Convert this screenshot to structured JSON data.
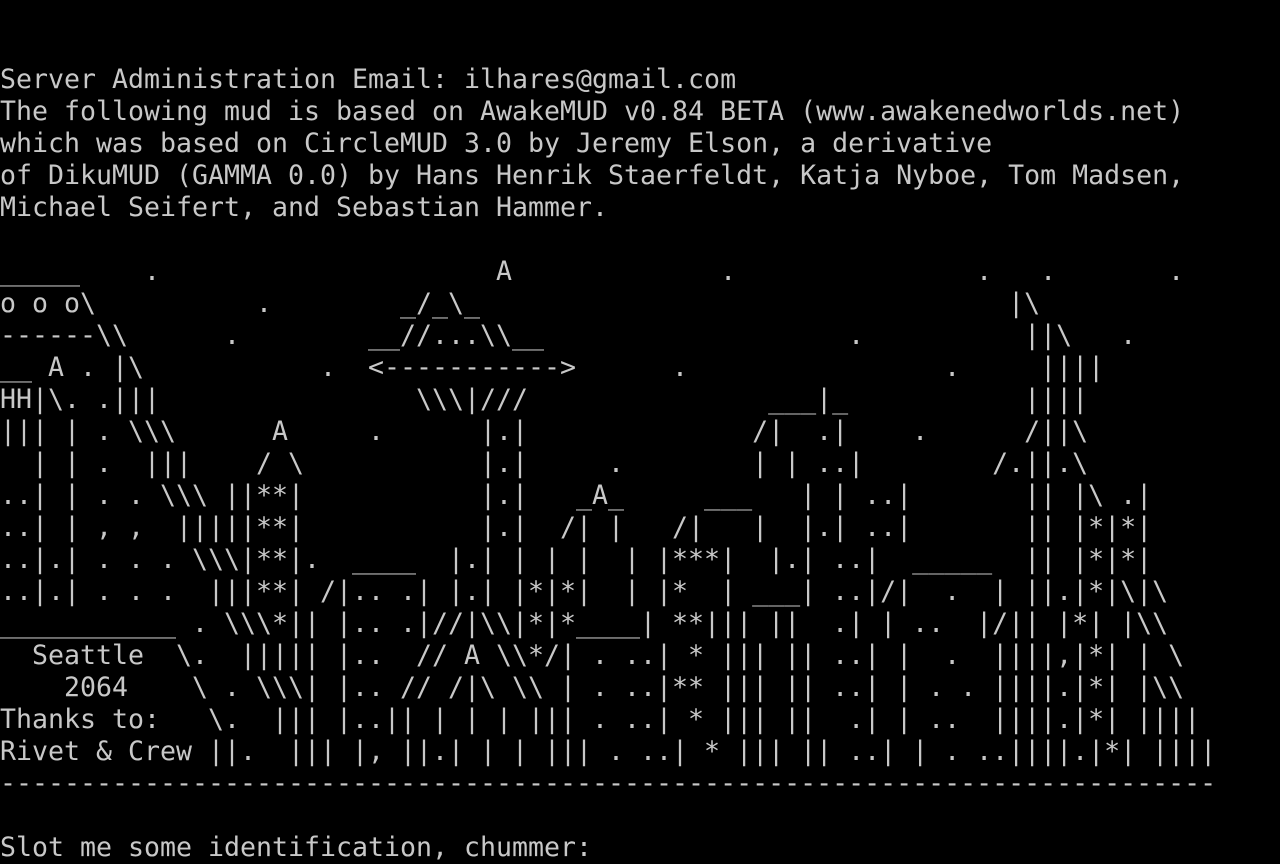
{
  "terminal": {
    "text_color": "#c8c8c8",
    "background_color": "#000000",
    "lines": [
      "Server Administration Email: ilhares@gmail.com",
      "The following mud is based on AwakeMUD v0.84 BETA (www.awakenedworlds.net)",
      "which was based on CircleMUD 3.0 by Jeremy Elson, a derivative",
      "of DikuMUD (GAMMA 0.0) by Hans Henrik Staerfeldt, Katja Nyboe, Tom Madsen,",
      "Michael Seifert, and Sebastian Hammer.",
      "",
      "_____    .                     A             .               .   .       .",
      "o o o\\          .        _/_\\_                                 |\\",
      "------\\\\      .        __//...\\\\__                   .          ||\\   .",
      "__ A . |\\           .  <----------->      .                .     ||||",
      "HH|\\. .|||                \\\\\\|///               ___|_           ||||",
      "||| | . \\\\\\      A     .      |.|              /|  .|    .      /||\\",
      "  | | .  |||    / \\           |.|     .        | | ..|        /.||.\\",
      "..| | . . \\\\\\ ||**|           |.|   _A_     ___   | | ..|       || |\\ .|",
      "..| | , ,  |||||**|           |.|  /| |   /|   |  |.| ..|       || |*|*|",
      "..|.| . . . \\\\\\|**|.  ____  |.| | | |  | |***|  |.| ..|  _____  || |*|*|",
      "..|.| . . .  |||**| /|.. .| |.| |*|*|  | |*  | ___| ..|/|  .  | ||.|*|\\|\\",
      "___________ . \\\\\\*|| |.. .|//|\\\\|*|*____| **||| ||  .| | ..  |/|| |*| |\\\\",
      "  Seattle  \\.  ||||| |..  // A \\\\*/| . ..| * ||| || ..| |  .  ||||,|*| | \\",
      "    2064    \\ . \\\\\\| |.. // /|\\ \\\\ | . ..|** ||| || ..| | . . ||||.|*| |\\\\",
      "Thanks to:   \\.  ||| |..|| | | | ||| . ..| * ||| ||  .| | ..  ||||.|*| ||||",
      "Rivet & Crew ||.  ||| |, ||.| | | ||| . ..| * ||| || ..| | . ..||||.|*| ||||",
      "----------------------------------------------------------------------------",
      ""
    ],
    "prompt": "Slot me some identification, chummer: ",
    "input_value": ""
  }
}
